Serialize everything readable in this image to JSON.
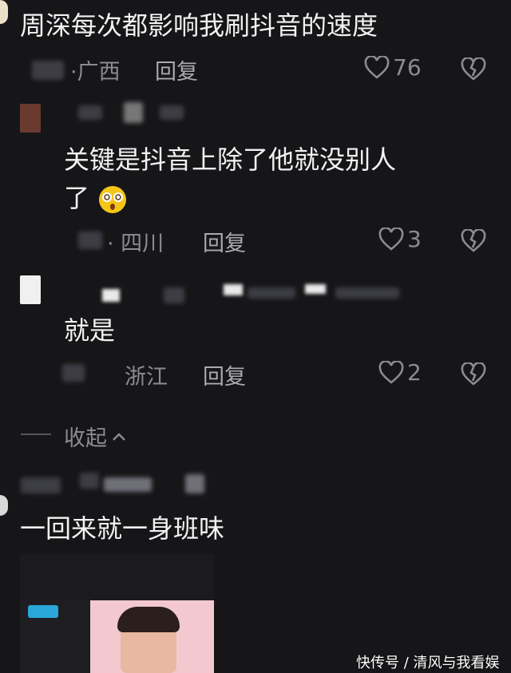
{
  "comment1": {
    "text": "周深每次都影响我刷抖音的速度",
    "location": "广西",
    "reply_label": "回复",
    "likes": "76"
  },
  "reply1": {
    "text_line1": "关键是抖音上除了他就没别人",
    "text_line2": "了",
    "emoji": "dizzy-face-emoji",
    "location": "· 四川",
    "reply_label": "回复",
    "likes": "3"
  },
  "reply2": {
    "text": "就是",
    "location": "浙江",
    "reply_label": "回复",
    "likes": "2"
  },
  "collapse": {
    "label": "收起",
    "icon": "chevron-up-icon"
  },
  "comment2": {
    "text": "一回来就一身班味"
  },
  "watermark": {
    "text": "快传号 / 清风与我看娱"
  },
  "colors": {
    "background": "#161619",
    "text": "#f2f2f2",
    "meta": "#8b8b92"
  }
}
